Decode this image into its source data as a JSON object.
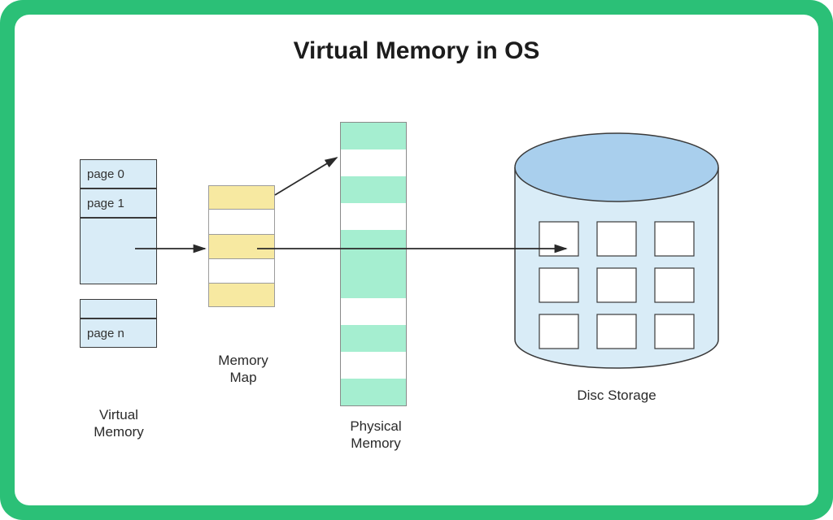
{
  "title": "Virtual Memory in OS",
  "virtual_memory": {
    "label": "Virtual\nMemory",
    "pages": [
      "page 0",
      "page 1",
      "",
      "",
      "page n"
    ]
  },
  "memory_map": {
    "label": "Memory\nMap",
    "rows": [
      "filled",
      "empty",
      "filled",
      "empty",
      "filled"
    ]
  },
  "physical_memory": {
    "label": "Physical\nMemory",
    "rows": [
      "g",
      "w",
      "g",
      "w",
      "g",
      "thin",
      "g",
      "w",
      "g",
      "w",
      "g"
    ]
  },
  "disc_storage": {
    "label": "Disc Storage",
    "blocks": 9
  },
  "colors": {
    "frame": "#2bc077",
    "vm_fill": "#d9ecf7",
    "mm_fill": "#f7e9a1",
    "pm_fill": "#a5eed0",
    "disc_fill": "#d9ecf7",
    "disc_top": "#a9cfed"
  }
}
